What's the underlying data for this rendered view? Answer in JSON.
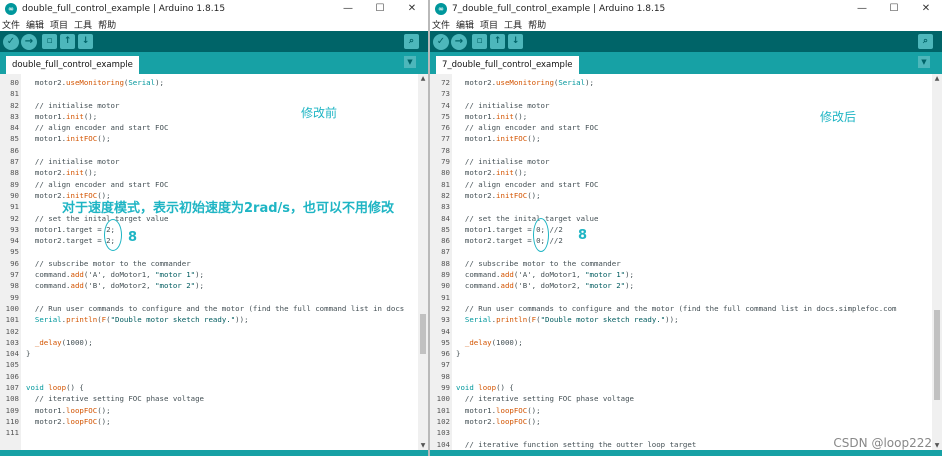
{
  "left": {
    "title": "double_full_control_example | Arduino 1.8.15",
    "menu": [
      "文件",
      "编辑",
      "项目",
      "工具",
      "帮助"
    ],
    "tab": "double_full_control_example",
    "lines": [
      {
        "n": "80",
        "c": "motor2.useMonitoring(Serial);"
      },
      {
        "n": "81",
        "c": ""
      },
      {
        "n": "82",
        "c": "// initialise motor"
      },
      {
        "n": "83",
        "c": "motor1.init();"
      },
      {
        "n": "84",
        "c": "// align encoder and start FOC"
      },
      {
        "n": "85",
        "c": "motor1.initFOC();"
      },
      {
        "n": "86",
        "c": ""
      },
      {
        "n": "87",
        "c": "// initialise motor"
      },
      {
        "n": "88",
        "c": "motor2.init();"
      },
      {
        "n": "89",
        "c": "// align encoder and start FOC"
      },
      {
        "n": "90",
        "c": "motor2.initFOC();"
      },
      {
        "n": "91",
        "c": ""
      },
      {
        "n": "92",
        "c": "// set the inital target value"
      },
      {
        "n": "93",
        "c": "motor1.target = 2;"
      },
      {
        "n": "94",
        "c": "motor2.target = 2;"
      },
      {
        "n": "95",
        "c": ""
      },
      {
        "n": "96",
        "c": "// subscribe motor to the commander"
      },
      {
        "n": "97",
        "c": "command.add('A', doMotor1, \"motor 1\");"
      },
      {
        "n": "98",
        "c": "command.add('B', doMotor2, \"motor 2\");"
      },
      {
        "n": "99",
        "c": ""
      },
      {
        "n": "100",
        "c": "// Run user commands to configure and the motor (find the full command list in docs"
      },
      {
        "n": "101",
        "c": "Serial.println(F(\"Double motor sketch ready.\"));"
      },
      {
        "n": "102",
        "c": ""
      },
      {
        "n": "103",
        "c": "_delay(1000);"
      },
      {
        "n": "104",
        "c": "}",
        "indent": false
      },
      {
        "n": "105",
        "c": ""
      },
      {
        "n": "106",
        "c": ""
      },
      {
        "n": "107",
        "c": "void loop() {",
        "indent": false
      },
      {
        "n": "108",
        "c": "// iterative setting FOC phase voltage"
      },
      {
        "n": "109",
        "c": "motor1.loopFOC();"
      },
      {
        "n": "110",
        "c": "motor2.loopFOC();"
      },
      {
        "n": "111",
        "c": ""
      }
    ],
    "annot_title": "修改前",
    "annot_note": "对于速度模式，表示初始速度为2rad/s，也可以不用修改",
    "annot_eight": "8"
  },
  "right": {
    "title": "7_double_full_control_example | Arduino 1.8.15",
    "menu": [
      "文件",
      "编辑",
      "项目",
      "工具",
      "帮助"
    ],
    "tab": "7_double_full_control_example",
    "lines": [
      {
        "n": "72",
        "c": "motor2.useMonitoring(Serial);"
      },
      {
        "n": "73",
        "c": ""
      },
      {
        "n": "74",
        "c": "// initialise motor"
      },
      {
        "n": "75",
        "c": "motor1.init();"
      },
      {
        "n": "76",
        "c": "// align encoder and start FOC"
      },
      {
        "n": "77",
        "c": "motor1.initFOC();"
      },
      {
        "n": "78",
        "c": ""
      },
      {
        "n": "79",
        "c": "// initialise motor"
      },
      {
        "n": "80",
        "c": "motor2.init();"
      },
      {
        "n": "81",
        "c": "// align encoder and start FOC"
      },
      {
        "n": "82",
        "c": "motor2.initFOC();"
      },
      {
        "n": "83",
        "c": ""
      },
      {
        "n": "84",
        "c": "// set the inital target value"
      },
      {
        "n": "85",
        "c": "motor1.target = 0; //2"
      },
      {
        "n": "86",
        "c": "motor2.target = 0; //2"
      },
      {
        "n": "87",
        "c": ""
      },
      {
        "n": "88",
        "c": "// subscribe motor to the commander"
      },
      {
        "n": "89",
        "c": "command.add('A', doMotor1, \"motor 1\");"
      },
      {
        "n": "90",
        "c": "command.add('B', doMotor2, \"motor 2\");"
      },
      {
        "n": "91",
        "c": ""
      },
      {
        "n": "92",
        "c": "// Run user commands to configure and the motor (find the full command list in docs.simplefoc.com"
      },
      {
        "n": "93",
        "c": "Serial.println(F(\"Double motor sketch ready.\"));"
      },
      {
        "n": "94",
        "c": ""
      },
      {
        "n": "95",
        "c": "_delay(1000);"
      },
      {
        "n": "96",
        "c": "}",
        "indent": false
      },
      {
        "n": "97",
        "c": ""
      },
      {
        "n": "98",
        "c": ""
      },
      {
        "n": "99",
        "c": "void loop() {",
        "indent": false
      },
      {
        "n": "100",
        "c": "// iterative setting FOC phase voltage"
      },
      {
        "n": "101",
        "c": "motor1.loopFOC();"
      },
      {
        "n": "102",
        "c": "motor2.loopFOC();"
      },
      {
        "n": "103",
        "c": ""
      },
      {
        "n": "104",
        "c": "// iterative function setting the outter loop target"
      }
    ],
    "annot_title": "修改后",
    "annot_eight": "8"
  },
  "watermark": "CSDN @loop222",
  "colors": {
    "toolbar": "#006468",
    "tabbar": "#17a1a5",
    "comment": "#434f54",
    "function": "#d35400",
    "keyword": "#00979c",
    "string": "#005c5f",
    "annotation": "#1fb5c4"
  }
}
